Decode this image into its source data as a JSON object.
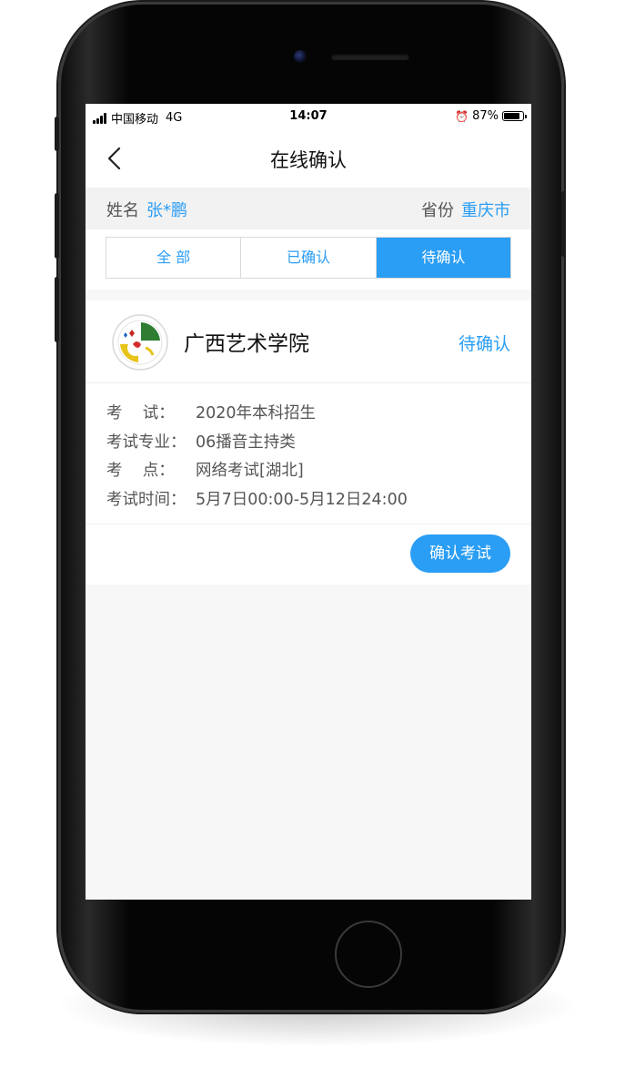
{
  "status_bar": {
    "carrier": "中国移动",
    "network": "4G",
    "time": "14:07",
    "battery_percent": "87%",
    "battery_level": 0.87,
    "alarm_icon": "alarm-clock-icon"
  },
  "nav": {
    "title": "在线确认",
    "back_icon": "chevron-left-icon"
  },
  "info": {
    "name_label": "姓名",
    "name_value": "张*鹏",
    "province_label": "省份",
    "province_value": "重庆市"
  },
  "tabs": [
    {
      "label": "全 部",
      "active": false
    },
    {
      "label": "已确认",
      "active": false
    },
    {
      "label": "待确认",
      "active": true
    }
  ],
  "exam_card": {
    "logo_icon": "school-logo-icon",
    "school_name": "广西艺术学院",
    "status": "待确认",
    "details": [
      {
        "key": "考    试：",
        "value": "2020年本科招生"
      },
      {
        "key": "考试专业：",
        "value": "06播音主持类"
      },
      {
        "key": "考    点：",
        "value": "网络考试[湖北]"
      },
      {
        "key": "考试时间：",
        "value": "5月7日00:00-5月12日24:00"
      }
    ],
    "confirm_label": "确认考试"
  },
  "colors": {
    "accent": "#2a9df4",
    "background": "#f7f7f7",
    "card": "#ffffff"
  }
}
